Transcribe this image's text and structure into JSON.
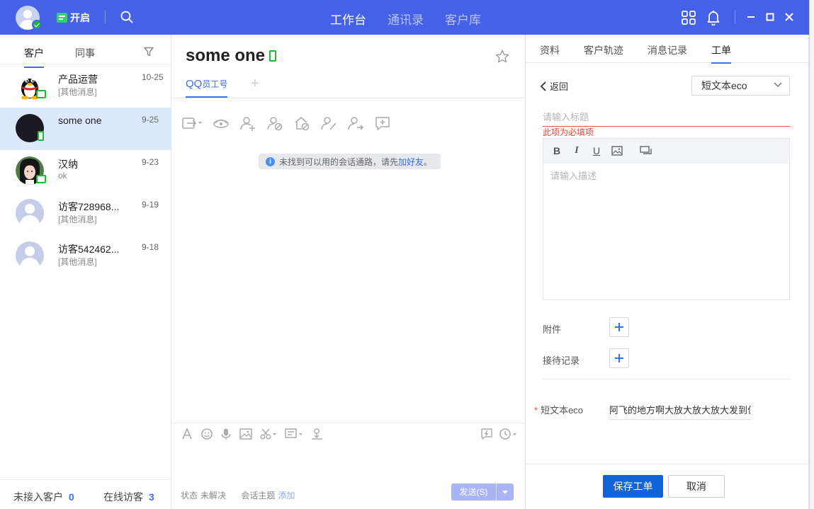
{
  "topbar": {
    "status_label": "开启",
    "nav": [
      {
        "label": "工作台",
        "active": true
      },
      {
        "label": "通讯录",
        "active": false
      },
      {
        "label": "客户库",
        "active": false
      }
    ]
  },
  "left": {
    "tabs": [
      "客户",
      "同事"
    ],
    "conversations": [
      {
        "name": "产品运营",
        "sub": "[其他消息]",
        "date": "10-25",
        "avatar": "qq-penguin-icon",
        "channel": "desktop"
      },
      {
        "name": "some one",
        "sub": "",
        "date": "9-25",
        "avatar": "dark-avatar",
        "channel": "mobile"
      },
      {
        "name": "汉纳",
        "sub": "ok",
        "date": "9-23",
        "avatar": "photo-avatar",
        "channel": "desktop"
      },
      {
        "name": "访客728968...",
        "sub": "[其他消息]",
        "date": "9-19",
        "avatar": "default-avatar",
        "channel": ""
      },
      {
        "name": "访客542462...",
        "sub": "[其他消息]",
        "date": "9-18",
        "avatar": "default-avatar",
        "channel": ""
      }
    ],
    "footer": {
      "unaccepted_label": "未接入客户",
      "unaccepted_count": "0",
      "online_label": "在线访客",
      "online_count": "3"
    }
  },
  "chat": {
    "title": "some one",
    "tab_label": "QQ",
    "tab_suffix": "员工号",
    "add_tab": "+",
    "notice_text": "未找到可以用的会话通路，请先",
    "notice_link": "加好友",
    "notice_end": "。",
    "status_label": "状态",
    "status_value": "未解决",
    "topic_label": "会话主题",
    "topic_add": "添加",
    "send_label": "发送(S)"
  },
  "right": {
    "tabs": [
      {
        "label": "资料",
        "active": false
      },
      {
        "label": "客户轨迹",
        "active": false
      },
      {
        "label": "消息记录",
        "active": false
      },
      {
        "label": "工单",
        "active": true
      }
    ],
    "back_label": "返回",
    "type_select": "短文本eco",
    "title_placeholder": "请输入标题",
    "required_error": "此项为必填项",
    "description_placeholder": "请输入描述",
    "attachment_label": "附件",
    "reception_label": "接待记录",
    "eco_label": "短文本eco",
    "eco_value": "阿飞的地方啊大放大放大放大发到位",
    "save_label": "保存工单",
    "cancel_label": "取消"
  },
  "colors": {
    "brand": "#4461e7",
    "accent": "#3a6fe7",
    "primary_button": "#0f64d8",
    "online": "#1bb934",
    "error": "#e8453c"
  }
}
